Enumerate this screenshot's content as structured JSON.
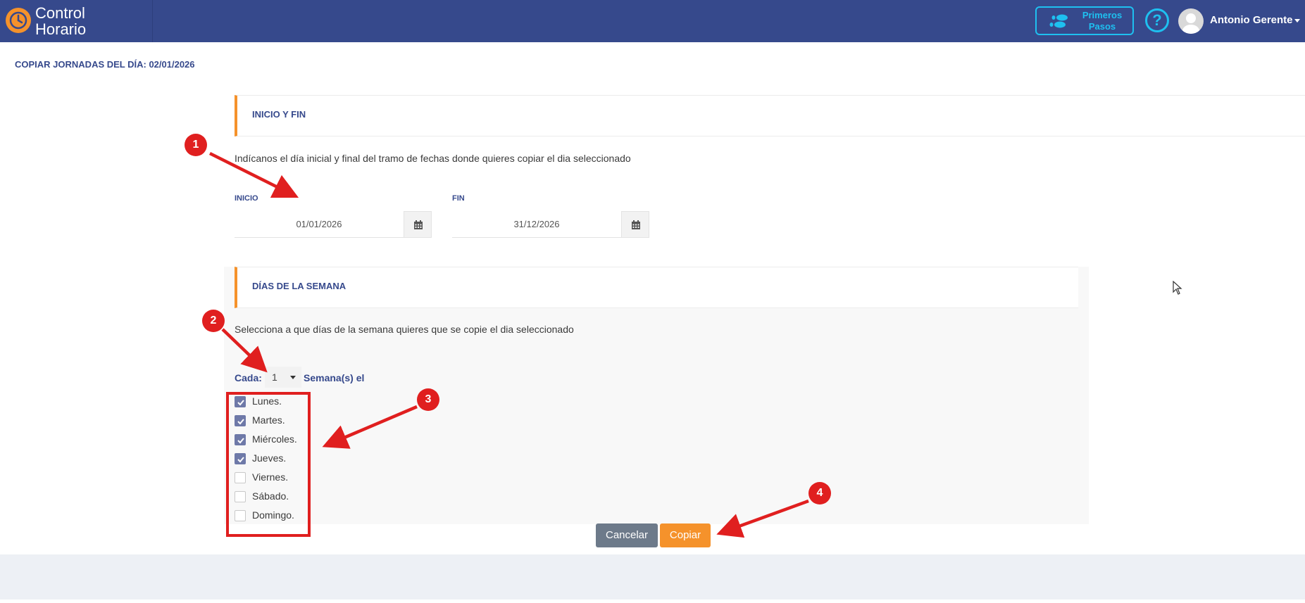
{
  "app": {
    "logo_line1": "Control",
    "logo_line2": "Horario",
    "brand_color": "#36498c",
    "accent_color": "#f5922b"
  },
  "header": {
    "first_steps_line1": "Primeros",
    "first_steps_line2": "Pasos",
    "help_symbol": "?",
    "user_name": "Antonio Gerente"
  },
  "page": {
    "title": "COPIAR JORNADAS DEL DÍA: 02/01/2026"
  },
  "range_section": {
    "title": "INICIO Y FIN",
    "description": "Indícanos el día inicial y final del tramo de fechas donde quieres copiar el dia seleccionado",
    "start_label": "INICIO",
    "start_value": "01/01/2026",
    "end_label": "FIN",
    "end_value": "31/12/2026"
  },
  "weekday_section": {
    "title": "DÍAS DE LA SEMANA",
    "description": "Selecciona a que días de la semana quieres que se copie el dia seleccionado",
    "every_label": "Cada:",
    "every_value": "1",
    "weeks_label": "Semana(s) el",
    "days": [
      {
        "label": "Lunes.",
        "checked": true
      },
      {
        "label": "Martes.",
        "checked": true
      },
      {
        "label": "Miércoles.",
        "checked": true
      },
      {
        "label": "Jueves.",
        "checked": true
      },
      {
        "label": "Viernes.",
        "checked": false
      },
      {
        "label": "Sábado.",
        "checked": false
      },
      {
        "label": "Domingo.",
        "checked": false
      }
    ]
  },
  "actions": {
    "cancel_label": "Cancelar",
    "copy_label": "Copiar"
  },
  "annotations": {
    "markers": [
      "1",
      "2",
      "3",
      "4"
    ],
    "color": "#e01f1f"
  }
}
